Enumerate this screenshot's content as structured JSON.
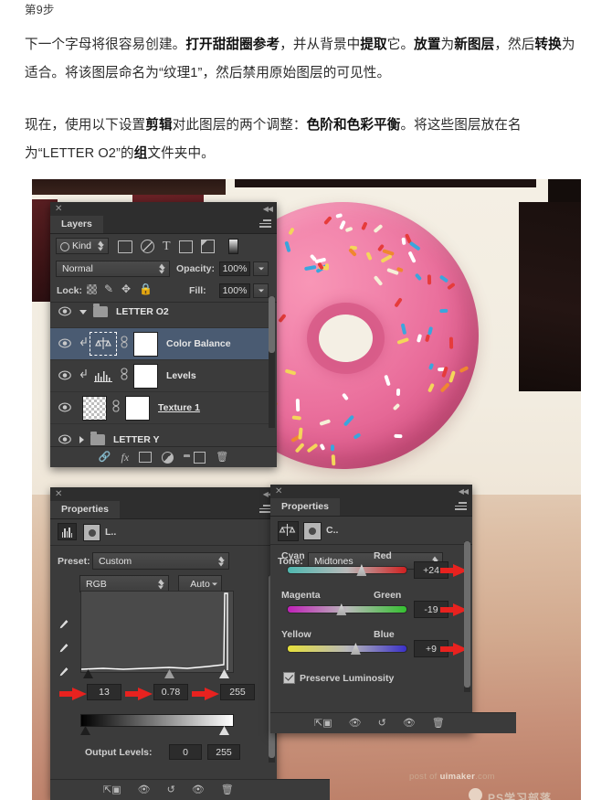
{
  "article": {
    "step_label": "第9步",
    "paragraph1_html": "下一个字母将很容易创建。<b>打开甜甜圈参考</b>，并从背景中<b>提取</b>它。<b>放置</b>为<b>新图层</b>，然后<b>转换</b>为适合。将该图层命名为“纹理1”，然后禁用原始图层的可见性。",
    "paragraph2_html": "现在，使用以下设置<b>剪辑</b>对此图层的两个调整：<b>色阶和色彩平衡</b>。将这些图层放在名为“LETTER O2”的<b>组</b>文件夹中。"
  },
  "layers_panel": {
    "tab": "Layers",
    "filter": {
      "label": "Kind",
      "icon": "search-icon"
    },
    "filter_icons": [
      "pixel-layer-icon",
      "adjustment-layer-icon",
      "type-layer-icon",
      "shape-layer-icon",
      "smart-object-icon",
      "mask-toggle-icon"
    ],
    "blend_mode": "Normal",
    "opacity_label": "Opacity:",
    "opacity_value": "100%",
    "lock_label": "Lock:",
    "lock_icons": [
      "lock-transparency-icon",
      "lock-image-icon",
      "lock-position-icon",
      "lock-all-icon"
    ],
    "fill_label": "Fill:",
    "fill_value": "100%",
    "rows": [
      {
        "name": "LETTER O2",
        "type": "group",
        "expanded": true,
        "selected": false,
        "visible": true,
        "clipped": false,
        "underline": false
      },
      {
        "name": "Color Balance",
        "type": "adjustment",
        "icon": "color-balance-icon",
        "selected": true,
        "visible": true,
        "clipped": true,
        "underline": false
      },
      {
        "name": "Levels",
        "type": "adjustment",
        "icon": "levels-icon",
        "selected": false,
        "visible": true,
        "clipped": true,
        "underline": false
      },
      {
        "name": "Texture 1",
        "type": "pixel",
        "selected": false,
        "visible": true,
        "clipped": false,
        "underline": true
      },
      {
        "name": "LETTER Y",
        "type": "group",
        "expanded": false,
        "selected": false,
        "visible": true,
        "clipped": false,
        "underline": false
      }
    ],
    "footer_icons": [
      "link-layers-icon",
      "layer-style-fx-icon",
      "add-mask-icon",
      "new-adjustment-icon",
      "new-group-icon",
      "new-layer-icon",
      "delete-layer-icon"
    ]
  },
  "levels_panel": {
    "tab": "Properties",
    "header_title": "L..",
    "header_icons": [
      "levels-icon",
      "mask-thumbnail-icon"
    ],
    "preset_label": "Preset:",
    "preset_value": "Custom",
    "channel_value": "RGB",
    "auto_label": "Auto",
    "eyedroppers": [
      "black-point-eyedropper",
      "gray-point-eyedropper",
      "white-point-eyedropper"
    ],
    "input_black": "13",
    "input_gamma": "0.78",
    "input_white": "255",
    "output_label": "Output Levels:",
    "output_black": "0",
    "output_white": "255",
    "footer_icons": [
      "clip-to-layer-icon",
      "preview-previous-icon",
      "reset-icon",
      "toggle-visibility-icon",
      "delete-adjustment-icon"
    ]
  },
  "color_balance_panel": {
    "tab": "Properties",
    "header_title": "C..",
    "header_icons": [
      "color-balance-icon",
      "mask-thumbnail-icon"
    ],
    "tone_label": "Tone:",
    "tone_value": "Midtones",
    "sliders": [
      {
        "left_label": "Cyan",
        "right_label": "Red",
        "value": "+24",
        "knob_pct": 58,
        "left_color": "#4fb8b0",
        "right_color": "#d02020"
      },
      {
        "left_label": "Magenta",
        "right_label": "Green",
        "value": "-19",
        "knob_pct": 41,
        "left_color": "#c020b8",
        "right_color": "#34c030"
      },
      {
        "left_label": "Yellow",
        "right_label": "Blue",
        "value": "+9",
        "knob_pct": 53,
        "left_color": "#e6e03a",
        "right_color": "#3a30c8"
      }
    ],
    "preserve_label": "Preserve Luminosity",
    "preserve_checked": true,
    "footer_icons": [
      "clip-to-layer-icon",
      "preview-previous-icon",
      "reset-icon",
      "toggle-visibility-icon",
      "delete-adjustment-icon"
    ]
  },
  "watermark": {
    "line1_pre": "post of ",
    "line1_brand": "uimaker",
    "line1_post": ".com",
    "line2": "PS学习部落"
  },
  "colors": {
    "panel_bg": "#3b3b3b",
    "panel_header": "#2e2e2e",
    "selected_row": "#4a5b72",
    "donut_pink": "#ea6f9c",
    "canvas_cream": "#f4efe4"
  }
}
